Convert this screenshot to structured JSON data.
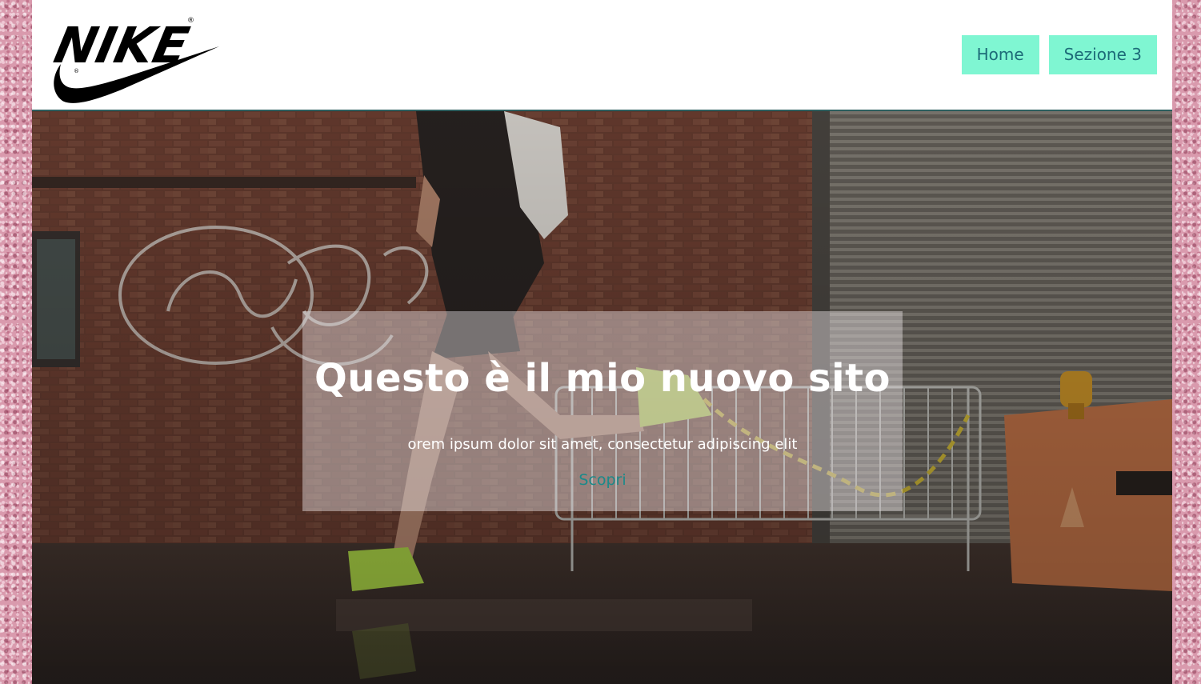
{
  "brand": {
    "logo_text": "NIKE"
  },
  "nav": {
    "items": [
      {
        "label": "Home"
      },
      {
        "label": "Sezione 3"
      }
    ]
  },
  "hero": {
    "title": "Questo è il mio nuovo sito",
    "subtitle": "orem ipsum dolor sit amet, consectetur adipiscing elit",
    "cta_label": "Scopri"
  },
  "colors": {
    "nav_button_bg": "#7ff6d2",
    "nav_button_text": "#1d6b78",
    "cta_text": "#1b8a8a",
    "header_border": "#2d5e5e",
    "page_background": "#d99aad"
  }
}
